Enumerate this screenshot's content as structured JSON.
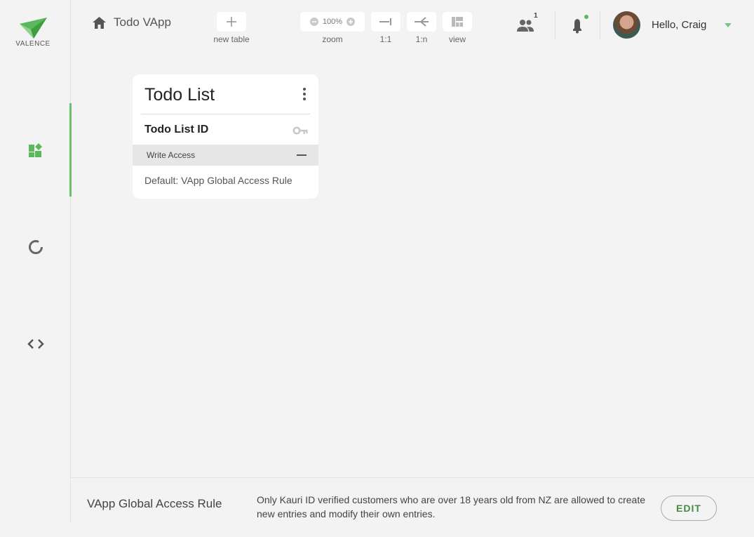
{
  "brand": {
    "name": "VALENCE",
    "accent": "#6cc06c"
  },
  "header": {
    "app_title": "Todo VApp",
    "tools": {
      "new_table_label": "new table",
      "zoom_label": "zoom",
      "zoom_value": "100%",
      "one_to_one_label": "1:1",
      "one_to_many_label": "1:n",
      "view_label": "view"
    },
    "users_count": "1",
    "greeting": "Hello, Craig"
  },
  "sidebar": {
    "items": [
      {
        "icon": "dashboard-icon",
        "active": true
      },
      {
        "icon": "loading-icon",
        "active": false
      },
      {
        "icon": "code-icon",
        "active": false
      }
    ]
  },
  "table_card": {
    "title": "Todo List",
    "field": "Todo List ID",
    "access_label": "Write Access",
    "access_rule": "Default: VApp Global Access Rule"
  },
  "footer": {
    "title": "VApp Global Access Rule",
    "description": "Only Kauri ID verified customers who are over 18 years old from NZ are allowed to create new entries and modify their own entries.",
    "edit_label": "EDIT"
  }
}
